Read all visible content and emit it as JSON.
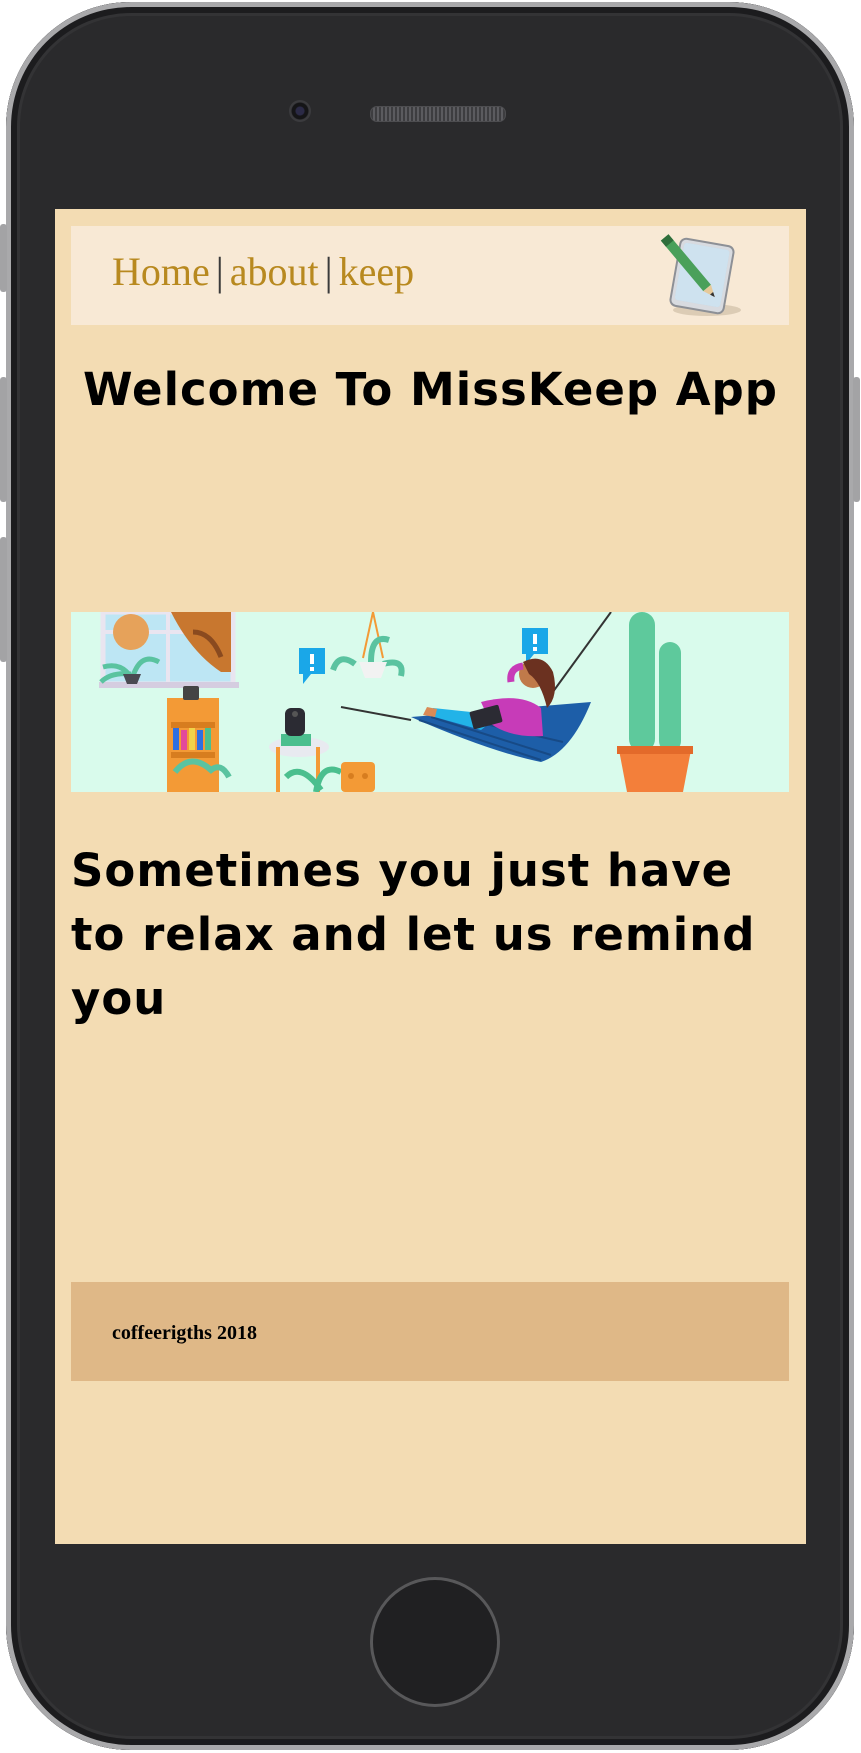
{
  "nav": {
    "home": "Home",
    "sep1": "|",
    "about": "about",
    "sep2": "|",
    "keep": "keep",
    "logo_icon": "notepad-pencil-icon"
  },
  "main": {
    "welcome": "Welcome To MissKeep App",
    "banner_illustration": "woman-relaxing-in-hammock-illustration",
    "tagline": "Sometimes you just have to relax and let us remind you"
  },
  "footer": {
    "text": "coffeerigths 2018"
  },
  "colors": {
    "screen_bg": "#f3dcb3",
    "nav_bg": "#f8e9d5",
    "link": "#b8891f",
    "banner_bg": "#d9fbec",
    "footer_bg": "#dfb887"
  }
}
